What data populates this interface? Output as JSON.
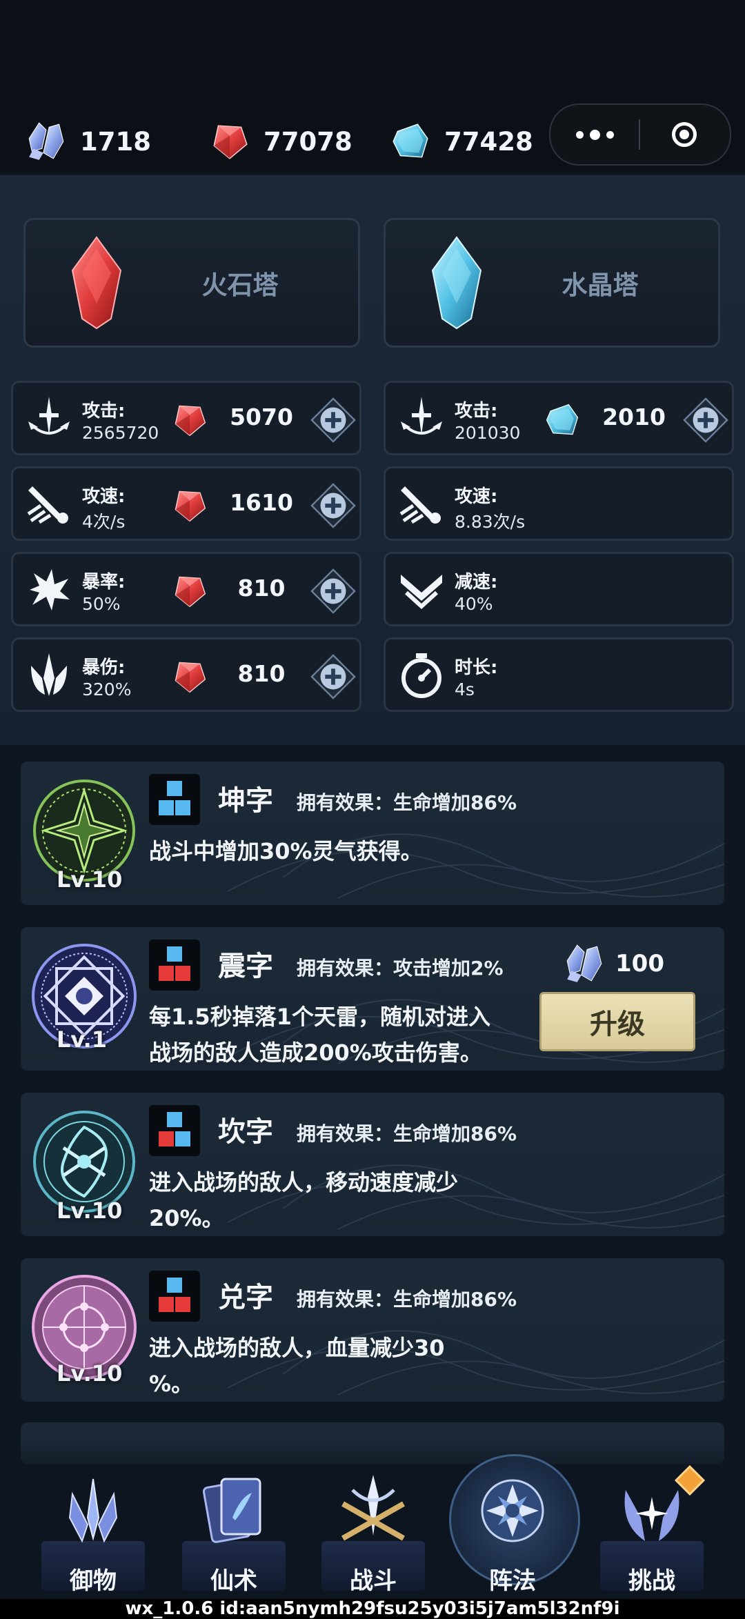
{
  "resources": [
    {
      "name": "spirit-crystal",
      "value": "1718"
    },
    {
      "name": "fire-stone",
      "value": "77078"
    },
    {
      "name": "water-crystal",
      "value": "77428"
    }
  ],
  "towers": {
    "fire": {
      "name": "火石塔"
    },
    "water": {
      "name": "水晶塔"
    }
  },
  "fire_stats": [
    {
      "label": "攻击:",
      "value": "2565720",
      "cost": "5070",
      "icon": "sword-icon"
    },
    {
      "label": "攻速:",
      "value": "4次/s",
      "cost": "1610",
      "icon": "attack-speed-icon"
    },
    {
      "label": "暴率:",
      "value": "50%",
      "cost": "810",
      "icon": "crit-rate-icon"
    },
    {
      "label": "暴伤:",
      "value": "320%",
      "cost": "810",
      "icon": "crit-damage-icon"
    }
  ],
  "water_stats": [
    {
      "label": "攻击:",
      "value": "201030",
      "cost": "2010",
      "icon": "sword-icon"
    },
    {
      "label": "攻速:",
      "value": "8.83次/s",
      "icon": "attack-speed-icon"
    },
    {
      "label": "减速:",
      "value": "40%",
      "icon": "slow-icon"
    },
    {
      "label": "时长:",
      "value": "4s",
      "icon": "stopwatch-icon"
    }
  ],
  "skills": [
    {
      "name": "坤字",
      "effect": "拥有效果：生命增加86%",
      "desc": [
        "战斗中增加30%灵气获得。"
      ],
      "level": "Lv.10"
    },
    {
      "name": "震字",
      "effect": "拥有效果：攻击增加2%",
      "desc": [
        "每1.5秒掉落1个天雷，随机对进入",
        "战场的敌人造成200%攻击伤害。"
      ],
      "level": "Lv.1",
      "upgrade_cost": "100",
      "upgrade_label": "升级"
    },
    {
      "name": "坎字",
      "effect": "拥有效果：生命增加86%",
      "desc": [
        "进入战场的敌人，移动速度减少",
        "20%。"
      ],
      "level": "Lv.10"
    },
    {
      "name": "兑字",
      "effect": "拥有效果：生命增加86%",
      "desc": [
        "进入战场的敌人，血量减少30",
        "%。"
      ],
      "level": "Lv.10"
    }
  ],
  "nav": [
    {
      "label": "御物",
      "icon": "flying-swords-icon"
    },
    {
      "label": "仙术",
      "icon": "spell-cards-icon"
    },
    {
      "label": "战斗",
      "icon": "battle-trident-icon"
    },
    {
      "label": "阵法",
      "icon": "formation-icon",
      "active": true
    },
    {
      "label": "挑战",
      "icon": "challenge-icon",
      "badge": true
    }
  ],
  "footer": "wx_1.0.6 id:aan5nymh29fsu25y03i5j7am5l32nf9i",
  "colors": {
    "fire": "#e04848",
    "water": "#5cc8e8",
    "accent": "#d8cb98"
  }
}
